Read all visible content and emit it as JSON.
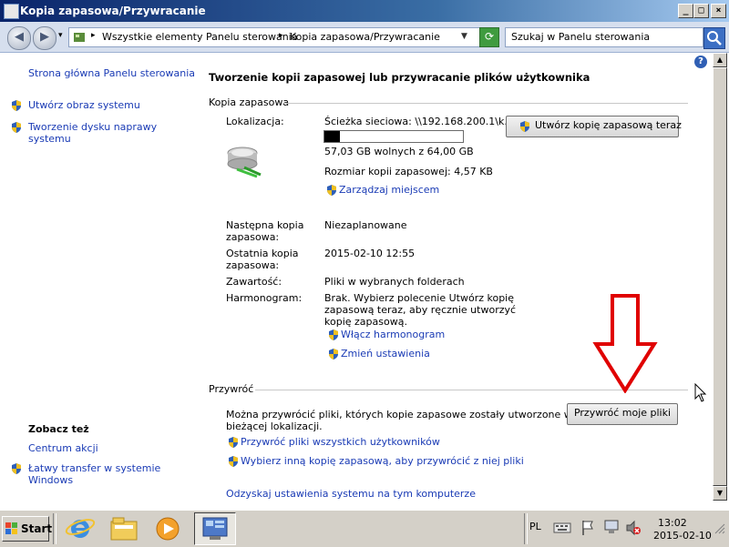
{
  "window": {
    "title": "Kopia zapasowa/Przywracanie"
  },
  "address": {
    "crumbs": [
      "Wszystkie elementy Panelu sterowania",
      "Kopia zapasowa/Przywracanie"
    ],
    "search_placeholder": "Szukaj w Panelu sterowania"
  },
  "sidebar": {
    "home": "Strona główna Panelu sterowania",
    "items": [
      "Utwórz obraz systemu",
      "Tworzenie dysku naprawy",
      "systemu"
    ],
    "see_also_title": "Zobacz też",
    "see_also": [
      "Centrum akcji",
      "Łatwy transfer w systemie",
      "Windows"
    ]
  },
  "main": {
    "heading": "Tworzenie kopii zapasowej lub przywracanie plików użytkownika",
    "backup": {
      "group_title": "Kopia zapasowa",
      "location_label": "Lokalizacja:",
      "location_value": "Ścieżka sieciowa: \\\\192.168.200.1\\k...",
      "free_space": "57,03 GB wolnych z 64,00 GB",
      "used_fraction": 0.11,
      "backup_size": "Rozmiar kopii zapasowej: 4,57 KB",
      "manage_space": "Zarządzaj miejscem",
      "backup_now_button": "Utwórz kopię zapasową teraz",
      "next_label_1": "Następna kopia",
      "next_label_2": "zapasowa:",
      "next_value": "Niezaplanowane",
      "last_label_1": "Ostatnia kopia",
      "last_label_2": "zapasowa:",
      "last_value": "2015-02-10 12:55",
      "contents_label": "Zawartość:",
      "contents_value": "Pliki w wybranych folderach",
      "schedule_label": "Harmonogram:",
      "schedule_lines": [
        "Brak. Wybierz polecenie Utwórz kopię",
        "zapasową teraz, aby ręcznie utworzyć",
        "kopię zapasową."
      ],
      "enable_schedule": "Włącz harmonogram",
      "change_settings": "Zmień ustawienia"
    },
    "restore": {
      "group_title": "Przywróć",
      "desc_lines": [
        "Można przywrócić pliki, których kopie zapasowe zostały utworzone w",
        "bieżącej lokalizacji."
      ],
      "restore_button": "Przywróć moje pliki",
      "restore_all_users": "Przywróć pliki wszystkich użytkowników",
      "select_other": "Wybierz inną kopię zapasową, aby przywrócić z niej pliki",
      "recover_system": "Odzyskaj ustawienia systemu na tym komputerze"
    }
  },
  "taskbar": {
    "start_label": "Start",
    "language": "PL",
    "time": "13:02",
    "date": "2015-02-10"
  },
  "colors": {
    "link": "#1a3bb5",
    "annotation_arrow": "#e00000",
    "titlebar": "#0a246a"
  }
}
